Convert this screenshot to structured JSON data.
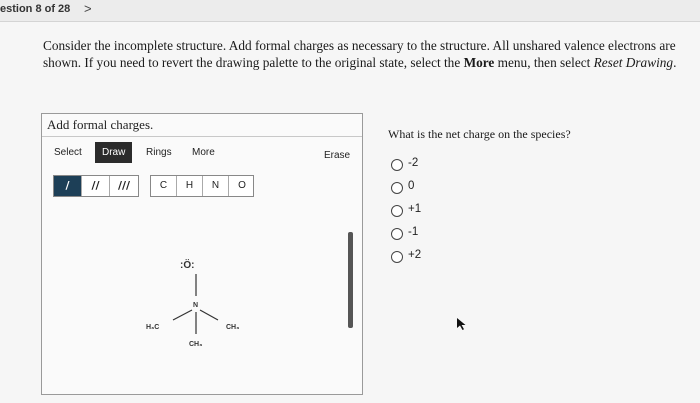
{
  "nav": {
    "question_counter": "estion 8 of 28",
    "next_icon": "chevron-right-icon",
    "next_glyph": ">"
  },
  "prompt": {
    "part1": "Consider the incomplete structure. Add formal charges as necessary to the structure. All unshared valence electrons are shown. If you need to revert the drawing palette to the original state, select the ",
    "more": "More",
    "part2": " menu, then select ",
    "reset": "Reset Drawing",
    "part3": "."
  },
  "panel": {
    "title": "Add formal charges.",
    "menu": {
      "select": "Select",
      "draw": "Draw",
      "rings": "Rings",
      "more": "More",
      "erase": "Erase"
    },
    "bonds": [
      "/",
      "//",
      "///"
    ],
    "atoms": [
      "C",
      "H",
      "N",
      "O"
    ],
    "molecule": {
      "oxygen": "O",
      "oxygen_lone_pairs": ":Ö:",
      "nitrogen": "N",
      "left_group": "H₃C",
      "right_group": "CH₃",
      "bottom_group": "CH₃"
    }
  },
  "question": {
    "text": "What is the net charge on the species?",
    "options": [
      "-2",
      "0",
      "+1",
      "-1",
      "+2"
    ]
  },
  "colors": {
    "active_menu": "#2b2b2b",
    "selected_bond": "#1d3f57"
  }
}
